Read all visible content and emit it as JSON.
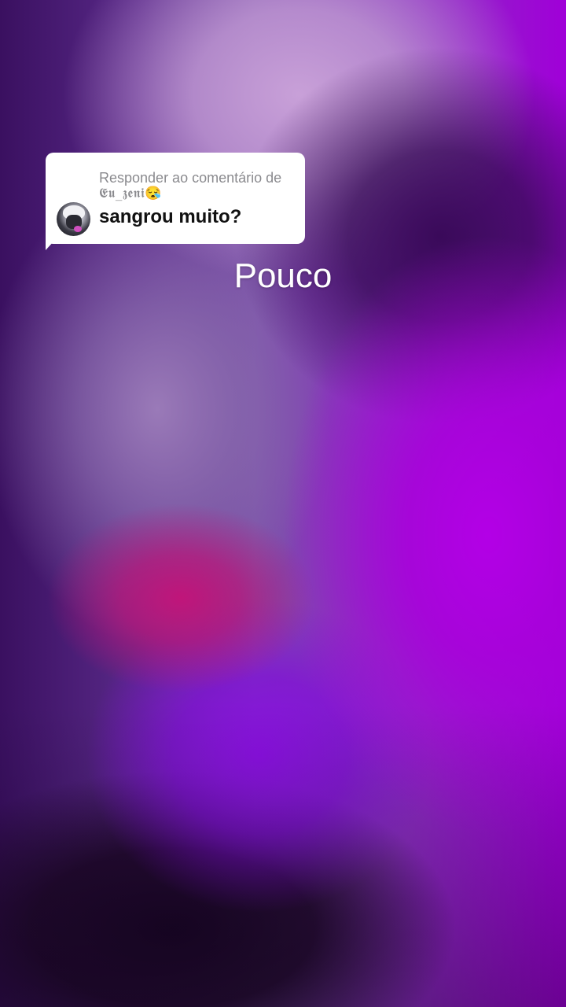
{
  "reply_card": {
    "header": "Responder ao comentário de",
    "username": "𝕰𝖚_𝖟𝖊𝖓𝖎😪",
    "comment": "sangrou muito?",
    "avatar_icon": "profile-avatar"
  },
  "video": {
    "overlay_text": "Pouco",
    "dominant_color": "#a000d8"
  }
}
